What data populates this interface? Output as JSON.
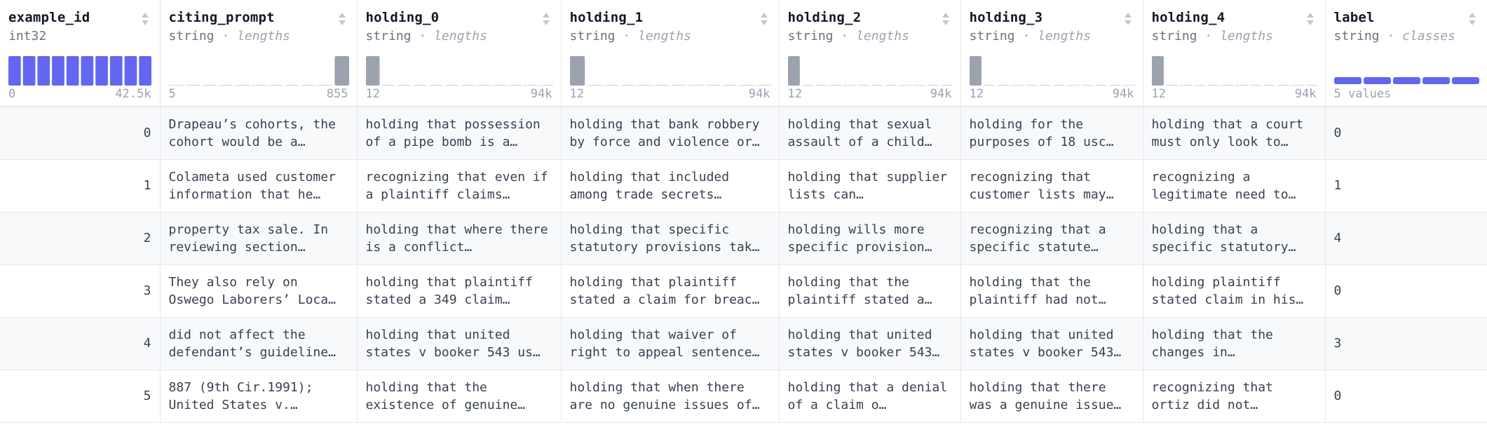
{
  "columns": [
    {
      "key": "example_id",
      "name": "example_id",
      "dtype": "int32",
      "stat": "",
      "viz": "histogram",
      "range_min": "0",
      "range_max": "42.5k",
      "bins": [
        1,
        1,
        1,
        1,
        1,
        1,
        1,
        1,
        1,
        1
      ],
      "bar_color": "#6366f1"
    },
    {
      "key": "citing_prompt",
      "name": "citing_prompt",
      "dtype": "string",
      "stat": "lengths",
      "viz": "histogram",
      "range_min": "5",
      "range_max": "855",
      "bins": [
        0.02,
        0.02,
        0.02,
        0.02,
        0.02,
        0.02,
        0.02,
        0.02,
        0.02,
        0.02,
        1
      ],
      "bar_color": "#9ca3af"
    },
    {
      "key": "holding_0",
      "name": "holding_0",
      "dtype": "string",
      "stat": "lengths",
      "viz": "histogram",
      "range_min": "12",
      "range_max": "94k",
      "bins": [
        1,
        0.02,
        0.02,
        0,
        0,
        0,
        0,
        0,
        0,
        0,
        0,
        0.01
      ],
      "bar_color": "#9ca3af"
    },
    {
      "key": "holding_1",
      "name": "holding_1",
      "dtype": "string",
      "stat": "lengths",
      "viz": "histogram",
      "range_min": "12",
      "range_max": "94k",
      "bins": [
        1,
        0.02,
        0.02,
        0,
        0,
        0,
        0,
        0,
        0,
        0,
        0,
        0.01
      ],
      "bar_color": "#9ca3af"
    },
    {
      "key": "holding_2",
      "name": "holding_2",
      "dtype": "string",
      "stat": "lengths",
      "viz": "histogram",
      "range_min": "12",
      "range_max": "94k",
      "bins": [
        1,
        0.02,
        0.02,
        0,
        0,
        0,
        0,
        0,
        0,
        0,
        0,
        0.01
      ],
      "bar_color": "#9ca3af"
    },
    {
      "key": "holding_3",
      "name": "holding_3",
      "dtype": "string",
      "stat": "lengths",
      "viz": "histogram",
      "range_min": "12",
      "range_max": "94k",
      "bins": [
        1,
        0.02,
        0.02,
        0,
        0,
        0,
        0,
        0,
        0,
        0,
        0,
        0.01
      ],
      "bar_color": "#9ca3af"
    },
    {
      "key": "holding_4",
      "name": "holding_4",
      "dtype": "string",
      "stat": "lengths",
      "viz": "histogram",
      "range_min": "12",
      "range_max": "94k",
      "bins": [
        1,
        0.02,
        0.02,
        0,
        0,
        0,
        0,
        0,
        0,
        0,
        0,
        0.01
      ],
      "bar_color": "#9ca3af"
    },
    {
      "key": "label",
      "name": "label",
      "dtype": "string",
      "stat": "classes",
      "viz": "classes",
      "range_min": "5 values",
      "range_max": "",
      "classes": 5,
      "bar_color": "#6366f1"
    }
  ],
  "rows": [
    {
      "example_id": "0",
      "citing_prompt": "Drapeau’s cohorts, the cohort would be a…",
      "holding_0": "holding that possession of a pipe bomb is a…",
      "holding_1": "holding that bank robbery by force and violence or…",
      "holding_2": "holding that sexual assault of a child…",
      "holding_3": "holding for the purposes of 18 usc…",
      "holding_4": "holding that a court must only look to…",
      "label": "0"
    },
    {
      "example_id": "1",
      "citing_prompt": "Colameta used customer information that he…",
      "holding_0": "recognizing that even if a plaintiff claims…",
      "holding_1": "holding that included among trade secrets…",
      "holding_2": "holding that supplier lists can…",
      "holding_3": "recognizing that customer lists may…",
      "holding_4": "recognizing a legitimate need to…",
      "label": "1"
    },
    {
      "example_id": "2",
      "citing_prompt": "property tax sale. In reviewing section…",
      "holding_0": "holding that where there is a conflict…",
      "holding_1": "holding that specific statutory provisions tak…",
      "holding_2": "holding wills more specific provision…",
      "holding_3": "recognizing that a specific statute…",
      "holding_4": "holding that a specific statutory…",
      "label": "4"
    },
    {
      "example_id": "3",
      "citing_prompt": "They also rely on Oswego Laborers’ Loca…",
      "holding_0": "holding that plaintiff stated a 349 claim…",
      "holding_1": "holding that plaintiff stated a claim for breac…",
      "holding_2": "holding that the plaintiff stated a…",
      "holding_3": "holding that the plaintiff had not…",
      "holding_4": "holding plaintiff stated claim in his…",
      "label": "0"
    },
    {
      "example_id": "4",
      "citing_prompt": "did not affect the defendant’s guideline…",
      "holding_0": "holding that united states v booker 543 us…",
      "holding_1": "holding that waiver of right to appeal sentence…",
      "holding_2": "holding that united states v booker 543…",
      "holding_3": "holding that united states v booker 543…",
      "holding_4": "holding that the changes in…",
      "label": "3"
    },
    {
      "example_id": "5",
      "citing_prompt": "887 (9th Cir.1991); United States v.…",
      "holding_0": "holding that the existence of genuine…",
      "holding_1": "holding that when there are no genuine issues of…",
      "holding_2": "holding that a denial of a claim o…",
      "holding_3": "holding that there was a genuine issue…",
      "holding_4": "recognizing that ortiz did not…",
      "label": "0"
    }
  ],
  "ui": {
    "sort_icon": "sort-arrows-icon",
    "type_separator": "·"
  }
}
